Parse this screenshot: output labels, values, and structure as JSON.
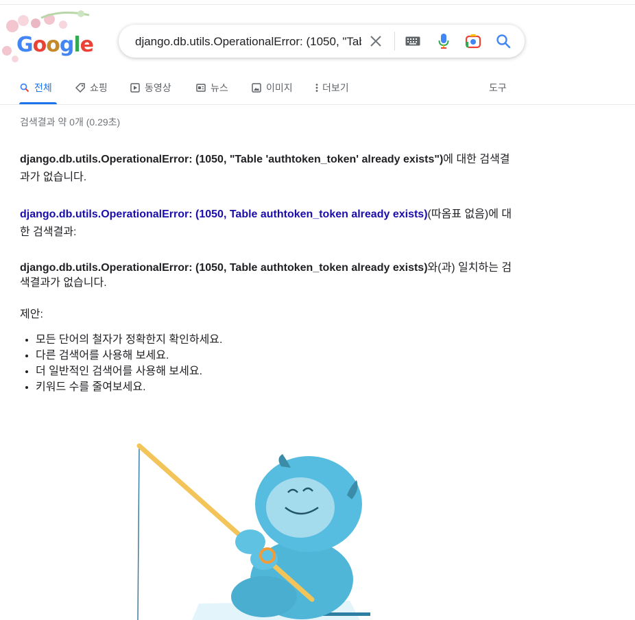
{
  "search": {
    "query": "django.db.utils.OperationalError: (1050, \"Table 'authtoken_token' already exists\")"
  },
  "tabs": [
    {
      "label": "전체",
      "icon": "search-icon"
    },
    {
      "label": "쇼핑",
      "icon": "tag-icon"
    },
    {
      "label": "동영상",
      "icon": "play-icon"
    },
    {
      "label": "뉴스",
      "icon": "news-icon"
    },
    {
      "label": "이미지",
      "icon": "image-icon"
    },
    {
      "label": "더보기",
      "icon": "more-vert-icon"
    }
  ],
  "tools_label": "도구",
  "result_stats": "검색결과 약 0개 (0.29초)",
  "no_results": {
    "query_bold": "django.db.utils.OperationalError: (1050, \"Table 'authtoken_token' already exists\")",
    "suffix": "에 대한 검색결과가 없습니다."
  },
  "unquoted": {
    "query_link": "django.db.utils.OperationalError: (1050, Table authtoken_token already exists)",
    "suffix": "(따옴표 없음)에 대한 검색결과:"
  },
  "no_match": {
    "query_bold": "django.db.utils.OperationalError: (1050, Table authtoken_token already exists)",
    "suffix": "와(과) 일치하는 검색결과가 없습니다."
  },
  "suggestions": {
    "title": "제안:",
    "items": [
      "모든 단어의 철자가 정확한지 확인하세요.",
      "다른 검색어를 사용해 보세요.",
      "더 일반적인 검색어를 사용해 보세요.",
      "키워드 수를 줄여보세요."
    ]
  },
  "colors": {
    "accent": "#1a73e8",
    "link": "#1a0dab",
    "yeti": "#4fb6d8"
  }
}
